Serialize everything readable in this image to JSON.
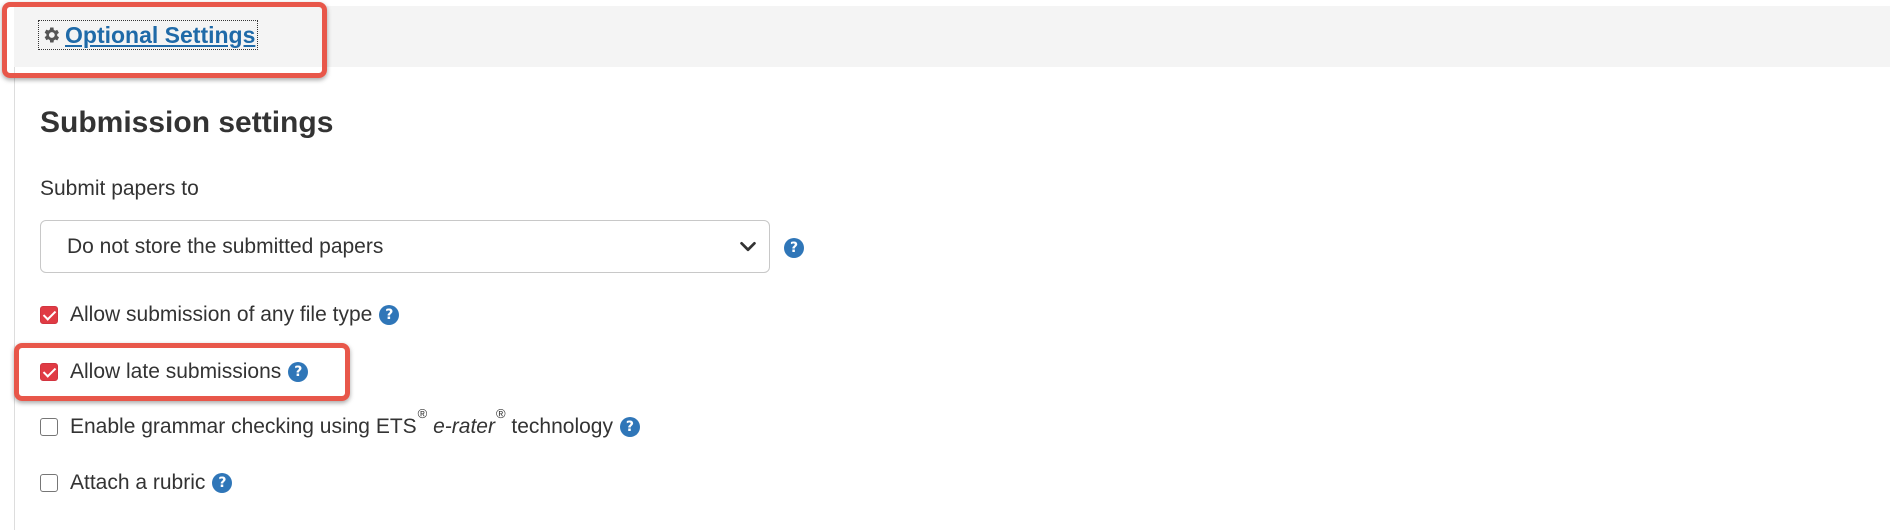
{
  "header": {
    "optional_settings_label": "Optional Settings",
    "optional_settings_icon": "gear-icon"
  },
  "submission": {
    "title": "Submission settings",
    "submit_papers_label": "Submit papers to",
    "submit_papers_value": "Do not store the submitted papers",
    "options": [
      {
        "label": "Allow submission of any file type",
        "checked": true
      },
      {
        "label": "Allow late submissions",
        "checked": true
      },
      {
        "label_parts": [
          "Enable grammar checking using ETS",
          "®",
          "e-rater",
          "®",
          "technology"
        ],
        "checked": false
      },
      {
        "label": "Attach a rubric",
        "checked": false
      }
    ]
  },
  "icons": {
    "help": "?",
    "help_icon_name": "help-circle-icon",
    "dropdown_icon_name": "chevron-down-icon"
  },
  "colors": {
    "link": "#1f6aa8",
    "checkbox_checked": "#e03b44",
    "help_icon": "#2f76b8",
    "highlight": "#e8574a"
  }
}
